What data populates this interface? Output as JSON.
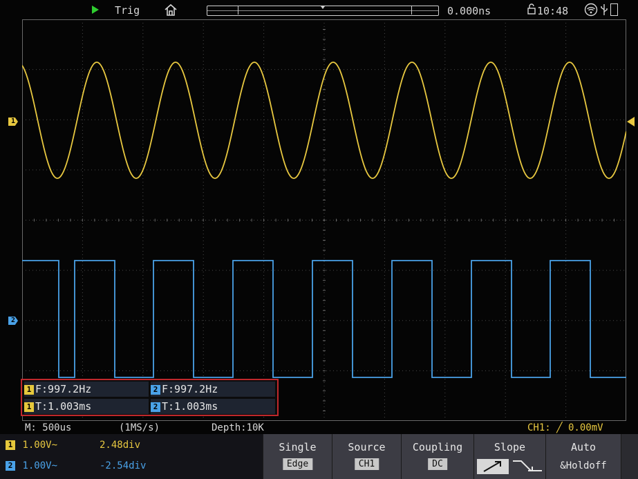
{
  "topbar": {
    "run_state": "Trig",
    "trigger_time": "0.000ns",
    "clock": "10:48"
  },
  "channels": {
    "ch1_marker": "1",
    "ch2_marker": "2",
    "ch1_color": "#e8c840",
    "ch2_color": "#4aa2e8"
  },
  "measurements": {
    "ch1_freq": "F:997.2Hz",
    "ch2_freq": "F:997.2Hz",
    "ch1_period": "T:1.003ms",
    "ch2_period": "T:1.003ms"
  },
  "status": {
    "timebase": "M: 500us",
    "sample_rate": "(1MS/s)",
    "depth": "Depth:10K",
    "trigger": "CH1: ╱ 0.00mV"
  },
  "channel_info": {
    "ch1_volts": "1.00V~",
    "ch1_offset": "2.48div",
    "ch2_volts": "1.00V~",
    "ch2_offset": "-2.54div"
  },
  "softkeys": {
    "single": {
      "title": "Single",
      "value": "Edge"
    },
    "source": {
      "title": "Source",
      "value": "CH1"
    },
    "coupling": {
      "title": "Coupling",
      "value": "DC"
    },
    "slope": {
      "title": "Slope"
    },
    "auto": {
      "title": "Auto",
      "value": "&Holdoff"
    }
  }
}
